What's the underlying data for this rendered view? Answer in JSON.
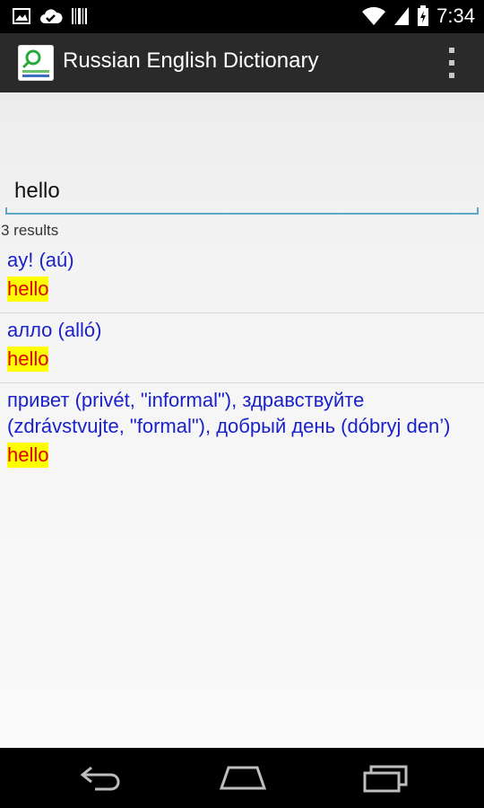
{
  "status_bar": {
    "time": "7:34",
    "icons_left": [
      "image-icon",
      "checkmark-cloud-icon",
      "barcode-icon"
    ],
    "icons_right": [
      "wifi-icon",
      "signal-icon",
      "battery-icon"
    ]
  },
  "action_bar": {
    "title": "Russian English Dictionary",
    "logo": "app-logo-icon",
    "overflow_icon": "overflow-menu-icon"
  },
  "search": {
    "value": "hello",
    "placeholder": ""
  },
  "results": {
    "count_label": "3 results",
    "items": [
      {
        "russian": "ay! (aú)",
        "english": "hello"
      },
      {
        "russian": "алло (alló)",
        "english": "hello"
      },
      {
        "russian": "привет (privét, \"informal\"), здравствуйте (zdrávstvujte, \"formal\"), добрый день (dóbryj den’)",
        "english": "hello"
      }
    ]
  },
  "navigation_bar": {
    "buttons": [
      "back-icon",
      "home-icon",
      "recent-apps-icon"
    ]
  },
  "colors": {
    "russian_text": "#1a22c8",
    "english_text": "#e00000",
    "highlight": "#ffff00",
    "accent": "#5ea7c8"
  }
}
